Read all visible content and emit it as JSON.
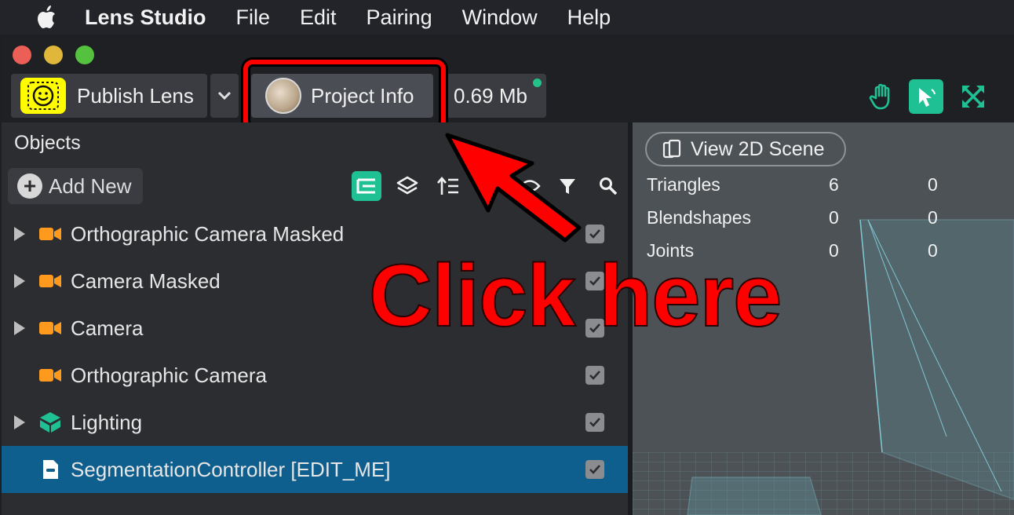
{
  "menubar": {
    "app_name": "Lens Studio",
    "items": [
      "File",
      "Edit",
      "Pairing",
      "Window",
      "Help"
    ]
  },
  "toolbar": {
    "publish_label": "Publish Lens",
    "project_info_label": "Project Info",
    "size_label": "0.69 Mb",
    "status_color": "#22c289",
    "accent_color": "#1fc194"
  },
  "objects_panel": {
    "title": "Objects",
    "add_new_label": "Add New",
    "items": [
      {
        "label": "Orthographic Camera Masked",
        "icon": "camera-icon",
        "expandable": true,
        "selected": false
      },
      {
        "label": "Camera Masked",
        "icon": "camera-icon",
        "expandable": true,
        "selected": false
      },
      {
        "label": "Camera",
        "icon": "camera-icon",
        "expandable": true,
        "selected": false
      },
      {
        "label": "Orthographic Camera",
        "icon": "camera-icon",
        "expandable": false,
        "selected": false
      },
      {
        "label": "Lighting",
        "icon": "lighting-icon",
        "expandable": true,
        "selected": false
      },
      {
        "label": "SegmentationController [EDIT_ME]",
        "icon": "script-icon",
        "expandable": false,
        "selected": true
      }
    ]
  },
  "scene_panel": {
    "view_2d_label": "View 2D Scene",
    "stats": [
      {
        "name": "Triangles",
        "a": "6",
        "b": "0"
      },
      {
        "name": "Blendshapes",
        "a": "0",
        "b": "0"
      },
      {
        "name": "Joints",
        "a": "0",
        "b": "0"
      }
    ]
  },
  "annotation": {
    "text": "Click here",
    "color": "#ff0000"
  }
}
